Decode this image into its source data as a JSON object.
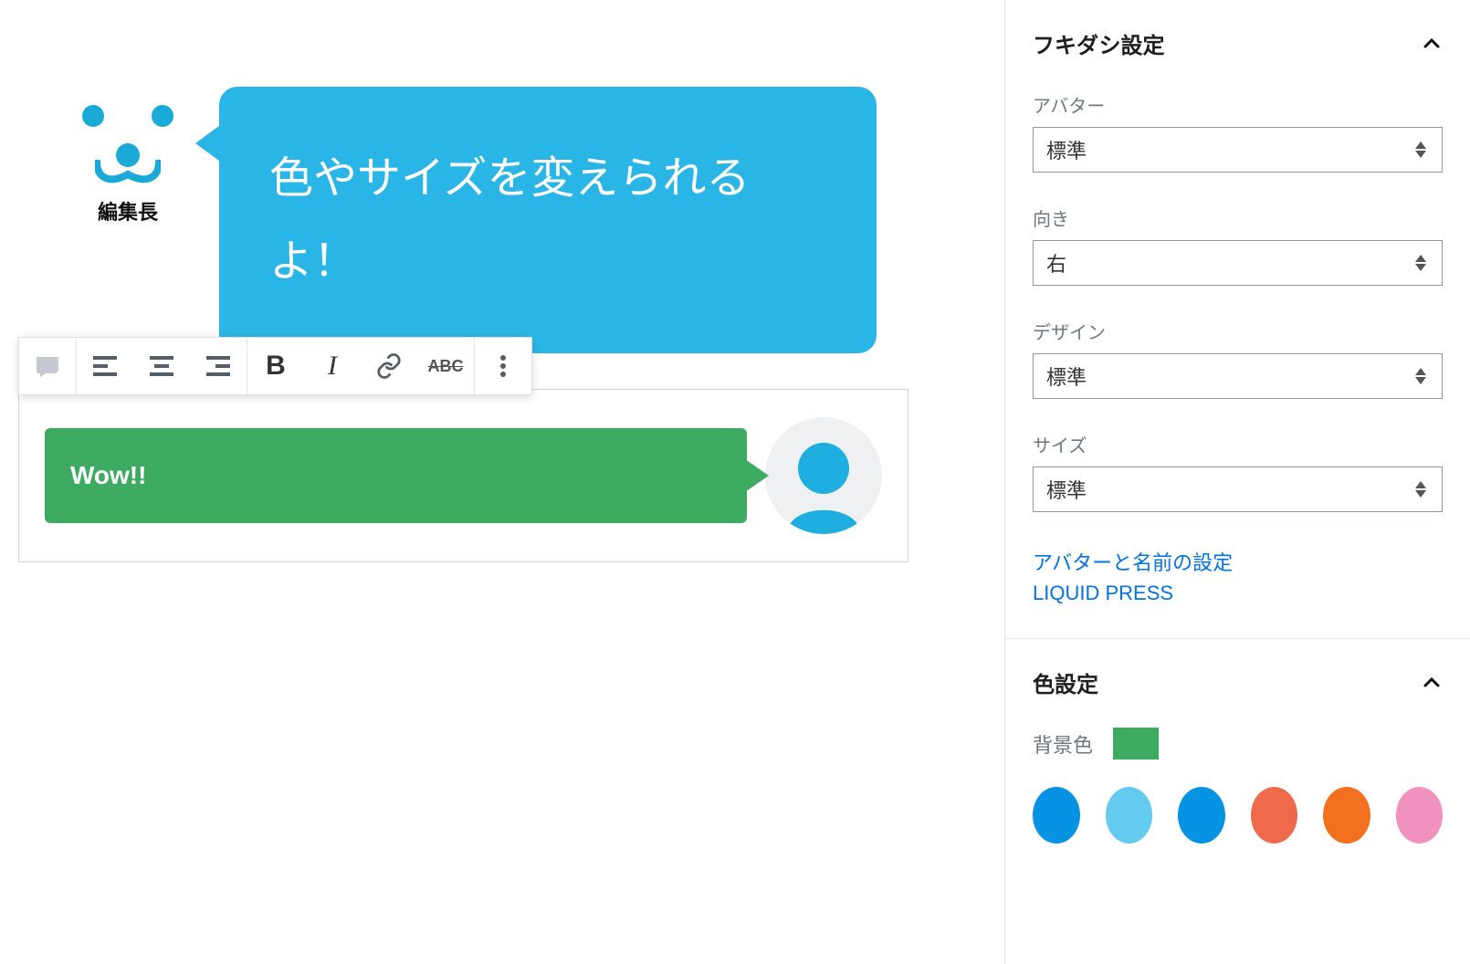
{
  "editor": {
    "top_block": {
      "avatar_name": "編集長",
      "bubble_text": "色やサイズを変えられるよ！"
    },
    "selected_block": {
      "bubble_text": "Wow!!"
    }
  },
  "sidebar": {
    "panel1": {
      "title": "フキダシ設定",
      "avatar_label": "アバター",
      "avatar_value": "標準",
      "direction_label": "向き",
      "direction_value": "右",
      "design_label": "デザイン",
      "design_value": "標準",
      "size_label": "サイズ",
      "size_value": "標準",
      "link1": "アバターと名前の設定",
      "link2": "LIQUID PRESS"
    },
    "panel2": {
      "title": "色設定",
      "bg_label": "背景色",
      "bg_color": "#3eab62",
      "colors": [
        "#0693e3",
        "#63caf0",
        "#0693e3",
        "#ef6a4a",
        "#f3701e",
        "#f191bd"
      ]
    }
  }
}
